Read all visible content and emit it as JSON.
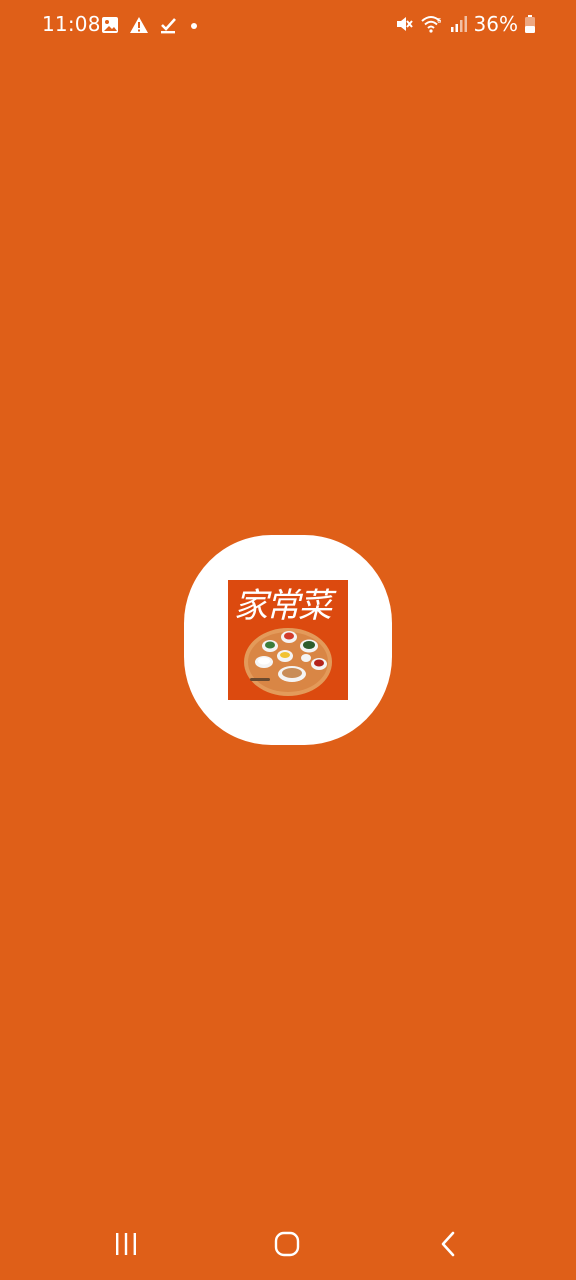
{
  "status_bar": {
    "time": "11:08",
    "left_icons": [
      "gallery-icon",
      "alert-icon",
      "download-done-icon",
      "notification-dot-icon"
    ],
    "right_icons": [
      "mute-icon",
      "wifi-icon",
      "signal-icon",
      "battery-icon"
    ],
    "battery_percent": "36%"
  },
  "splash": {
    "logo_text": "家常菜",
    "background_color": "#DF5F18",
    "icon_tile_color": "#DC4A0F"
  },
  "navigation_bar": {
    "buttons": [
      "recent-apps",
      "home",
      "back"
    ]
  }
}
